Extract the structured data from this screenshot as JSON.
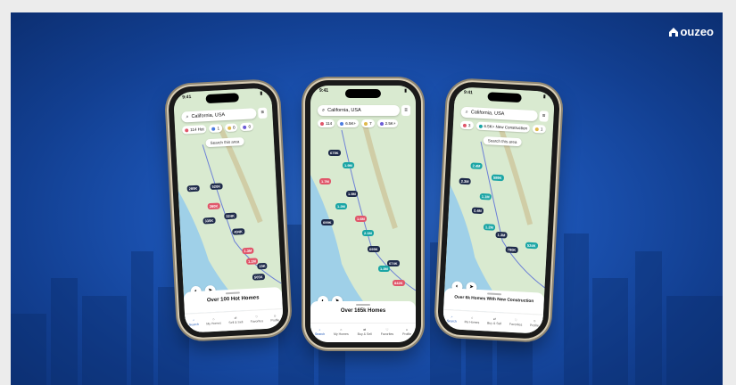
{
  "brand": {
    "name": "ouzeo",
    "mark_icon": "house-icon"
  },
  "colors": {
    "background": "#1d56b8",
    "accent": "#1d56b8",
    "pin_red": "#e0566a",
    "pin_navy": "#1e2a4a",
    "pin_teal": "#1aa5a5"
  },
  "phones": [
    {
      "time": "9:41",
      "search_text": "California, USA",
      "chips": [
        "114 Hot",
        "1",
        "0",
        "0"
      ],
      "search_area": "Search this area",
      "sheet_caption": "Over 100 Hot Homes",
      "pins": [
        "285K",
        "520K",
        "280K",
        "324K",
        "335K",
        "404K",
        "1.3M",
        "19K",
        "505K",
        "1.1M"
      ],
      "tabs": [
        "Search",
        "My Homes",
        "Sell & Sell",
        "Favorites",
        "Profile"
      ]
    },
    {
      "time": "9:41",
      "search_text": "California, USA",
      "chips": [
        "114",
        "6.5K+",
        "7",
        "2.5K+"
      ],
      "search_area": "",
      "sheet_caption": "Over 165k Homes",
      "pins": [
        "675K",
        "1.9M",
        "1.7M",
        "1.5M",
        "1.2M",
        "699K",
        "1.6M",
        "2.1M",
        "674K",
        "842K",
        "695K",
        "1.3M"
      ],
      "tabs": [
        "Search",
        "My Homes",
        "Buy & Sell",
        "Favorites",
        "Profile"
      ]
    },
    {
      "time": "9:41",
      "search_text": "California, USA",
      "chips": [
        "3",
        "6.5K+ New Construction",
        "1"
      ],
      "search_area": "Search this area",
      "sheet_caption": "Over 6k Homes With New Construction",
      "pins": [
        "2.4M",
        "2.3M",
        "1.1M",
        "2.4M",
        "1.2M",
        "790K",
        "524K",
        "1.3M",
        "589K"
      ],
      "tabs": [
        "Search",
        "My Homes",
        "Buy & Sell",
        "Favorites",
        "Profile"
      ]
    }
  ]
}
